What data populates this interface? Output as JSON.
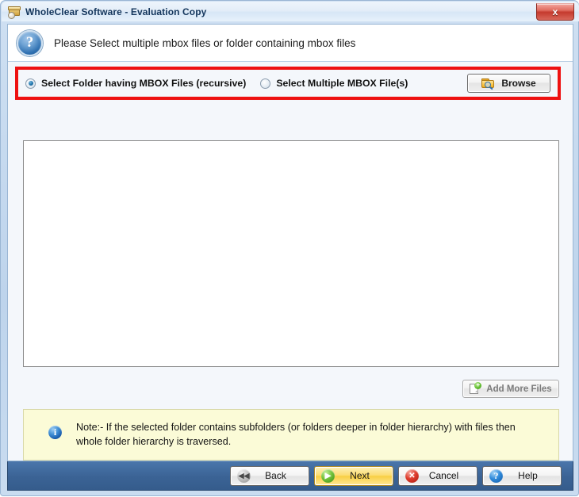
{
  "window": {
    "title": "WholeClear Software - Evaluation Copy",
    "app_icon": "mbox-archive-icon",
    "close_label": "x",
    "accent_red": "#ee1111",
    "titlebar_color": "#e3edf8",
    "footer_color": "#3b6395",
    "note_bg": "#fbfbd7"
  },
  "header": {
    "icon": "question-mark-icon",
    "instruction": "Please Select multiple mbox files or folder containing mbox files"
  },
  "options": {
    "highlighted": true,
    "radios": [
      {
        "label": "Select Folder having MBOX Files (recursive)",
        "checked": true
      },
      {
        "label": "Select Multiple MBOX File(s)",
        "checked": false
      }
    ],
    "browse": {
      "label": "Browse",
      "icon": "folder-search-icon",
      "enabled": true
    }
  },
  "file_list": {
    "items": [],
    "empty": true
  },
  "add_more": {
    "label": "Add More Files",
    "icon": "document-add-icon",
    "enabled": false
  },
  "note": {
    "icon": "info-icon",
    "text": "Note:- If the selected folder contains subfolders (or folders deeper in folder hierarchy) with files then whole folder hierarchy is traversed."
  },
  "footer": {
    "buttons": [
      {
        "label": "Back",
        "icon": "rewind-icon",
        "primary": false
      },
      {
        "label": "Next",
        "icon": "play-icon",
        "primary": true
      },
      {
        "label": "Cancel",
        "icon": "cancel-circle-icon",
        "primary": false
      },
      {
        "label": "Help",
        "icon": "question-circle-icon",
        "primary": false
      }
    ]
  }
}
